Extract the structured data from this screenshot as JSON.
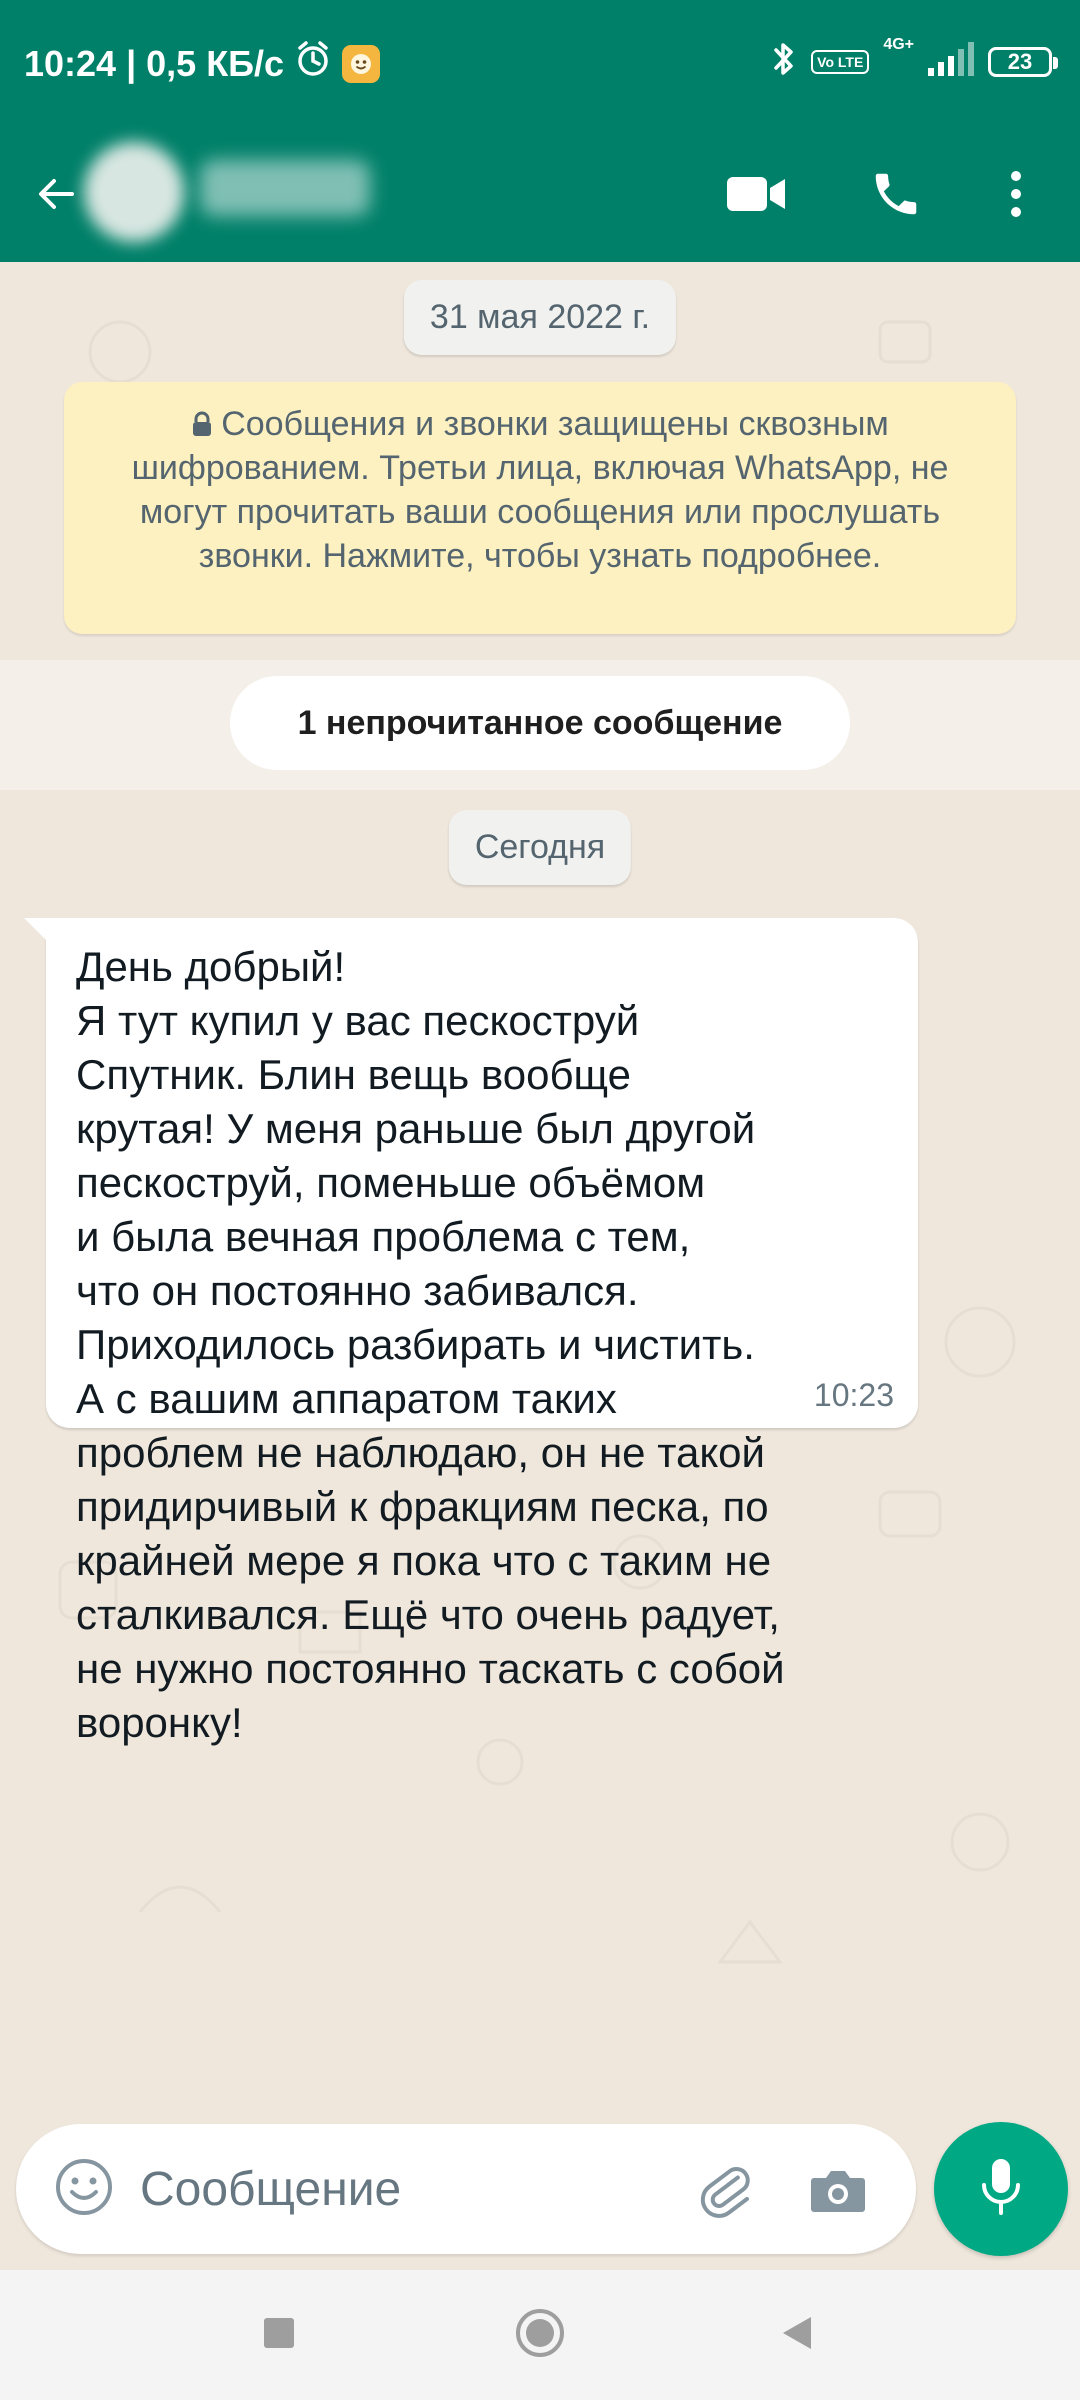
{
  "status_bar": {
    "time": "10:24",
    "net_speed": "0,5 КБ/с",
    "separator": "|",
    "volte_badge": "Vo LTE",
    "network": "4G+",
    "battery": "23"
  },
  "chat": {
    "date_chip_1": "31 мая 2022 г.",
    "encryption_notice": "Сообщения и звонки защищены сквозным шифрованием. Третьи лица, включая WhatsApp, не могут прочитать ваши сообщения или прослушать звонки. Нажмите, чтобы узнать подробнее.",
    "unread_pill": "1 непрочитанное сообщение",
    "date_chip_2": "Сегодня",
    "message": {
      "text": "День добрый!\nЯ тут купил у вас пескоструй\nСпутник. Блин вещь вообще\nкрутая! У меня раньше был другой\nпескоструй, поменьше объёмом\nи была вечная проблема с тем,\nчто он постоянно забивался.\nПриходилось разбирать и чистить.\nА с вашим аппаратом таких\nпроблем не наблюдаю, он не такой\nпридирчивый к фракциям песка, по\nкрайней мере я пока что с таким не\nсталкивался. Ещё что очень радует,\nне нужно постоянно таскать с собой\nворонку!",
      "time": "10:23"
    }
  },
  "input": {
    "placeholder": "Сообщение"
  },
  "colors": {
    "header": "#008069",
    "accent": "#00a884",
    "chat_bg": "#efe7dc",
    "notice_bg": "#fdf0c1"
  },
  "icons": {
    "back": "arrow-left-icon",
    "video": "video-camera-icon",
    "call": "phone-icon",
    "menu": "more-vertical-icon",
    "emoji": "smiley-icon",
    "attach": "paperclip-icon",
    "camera": "camera-icon",
    "mic": "microphone-icon"
  }
}
